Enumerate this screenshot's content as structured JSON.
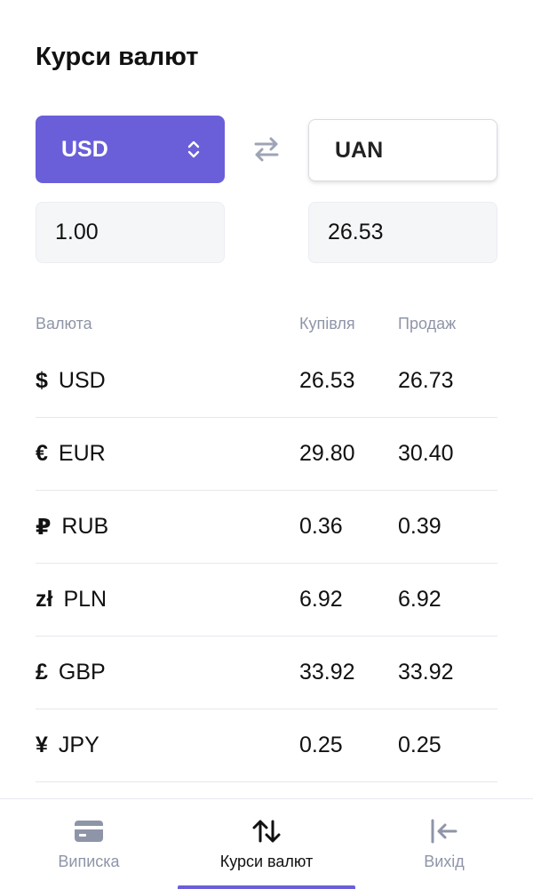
{
  "page": {
    "title": "Курси валют"
  },
  "converter": {
    "from_currency": "USD",
    "to_currency": "UAN",
    "from_amount": "1.00",
    "to_amount": "26.53"
  },
  "table": {
    "headers": {
      "currency": "Валюта",
      "buy": "Купівля",
      "sell": "Продаж"
    },
    "rows": [
      {
        "symbol": "$",
        "code": "USD",
        "buy": "26.53",
        "sell": "26.73"
      },
      {
        "symbol": "€",
        "code": "EUR",
        "buy": "29.80",
        "sell": "30.40"
      },
      {
        "symbol": "₽",
        "code": "RUB",
        "buy": "0.36",
        "sell": "0.39"
      },
      {
        "symbol": "zł",
        "code": "PLN",
        "buy": "6.92",
        "sell": "6.92"
      },
      {
        "symbol": "£",
        "code": "GBP",
        "buy": "33.92",
        "sell": "33.92"
      },
      {
        "symbol": "¥",
        "code": "JPY",
        "buy": "0.25",
        "sell": "0.25"
      }
    ]
  },
  "tabbar": {
    "tabs": [
      {
        "label": "Виписка",
        "icon": "card-icon"
      },
      {
        "label": "Курси валют",
        "icon": "arrows-up-down-icon",
        "active": true
      },
      {
        "label": "Вихід",
        "icon": "logout-icon"
      }
    ]
  },
  "colors": {
    "accent": "#6a5fd9",
    "muted": "#8f95a8",
    "field_bg": "#f5f6f8"
  }
}
